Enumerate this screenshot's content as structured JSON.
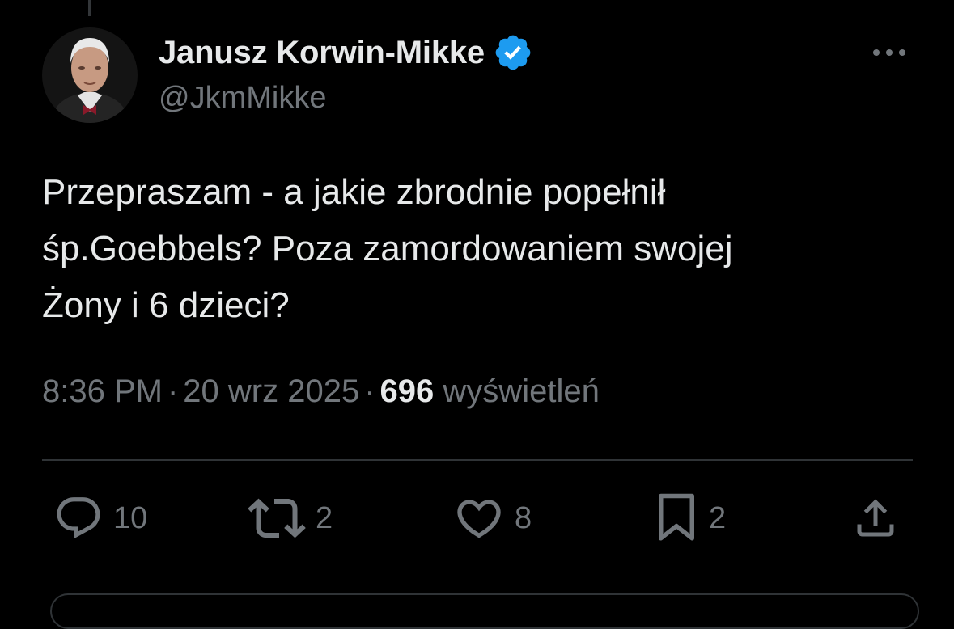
{
  "tweet": {
    "author": {
      "display_name": "Janusz Korwin-Mikke",
      "handle": "@JkmMikke",
      "verified": true,
      "verified_color": "#1d9bf0"
    },
    "text_lines": [
      "Przepraszam - a jakie zbrodnie popełnił",
      "śp.Goebbels? Poza zamordowaniem swojej",
      "Żony i 6 dzieci?"
    ],
    "meta": {
      "time": "8:36 PM",
      "separator": "·",
      "date": "20 wrz 2025",
      "views_count": "696",
      "views_label": "wyświetleń"
    },
    "actions": {
      "replies": {
        "icon": "reply-icon",
        "count": "10"
      },
      "reposts": {
        "icon": "repost-icon",
        "count": "2"
      },
      "likes": {
        "icon": "heart-icon",
        "count": "8"
      },
      "bookmarks": {
        "icon": "bookmark-icon",
        "count": "2"
      },
      "share": {
        "icon": "share-icon"
      }
    }
  },
  "colors": {
    "background": "#000000",
    "primary_text": "#e7e9ea",
    "secondary_text": "#71767b",
    "divider": "#2f3336",
    "accent": "#1d9bf0"
  }
}
